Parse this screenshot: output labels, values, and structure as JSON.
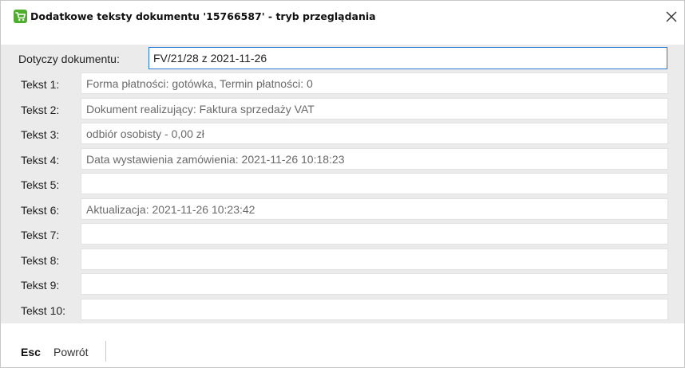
{
  "window": {
    "title": "Dodatkowe teksty dokumentu '15766587' - tryb przeglądania",
    "icon": "shopping-cart-icon",
    "accent_color": "#2a7ad5",
    "icon_color": "#4caf2a"
  },
  "reference": {
    "label": "Dotyczy dokumentu:",
    "value": "FV/21/28 z 2021-11-26"
  },
  "texts": [
    {
      "label": "Tekst 1:",
      "value": "Forma płatności: gotówka, Termin płatności: 0"
    },
    {
      "label": "Tekst 2:",
      "value": "Dokument realizujący: Faktura sprzedaży VAT"
    },
    {
      "label": "Tekst 3:",
      "value": "odbiór osobisty - 0,00 zł"
    },
    {
      "label": "Tekst 4:",
      "value": "Data wystawienia zamówienia: 2021-11-26 10:18:23"
    },
    {
      "label": "Tekst 5:",
      "value": ""
    },
    {
      "label": "Tekst 6:",
      "value": "Aktualizacja: 2021-11-26 10:23:42"
    },
    {
      "label": "Tekst 7:",
      "value": ""
    },
    {
      "label": "Tekst 8:",
      "value": ""
    },
    {
      "label": "Tekst 9:",
      "value": ""
    },
    {
      "label": "Tekst 10:",
      "value": ""
    }
  ],
  "footer": {
    "key": "Esc",
    "action": "Powrót"
  }
}
